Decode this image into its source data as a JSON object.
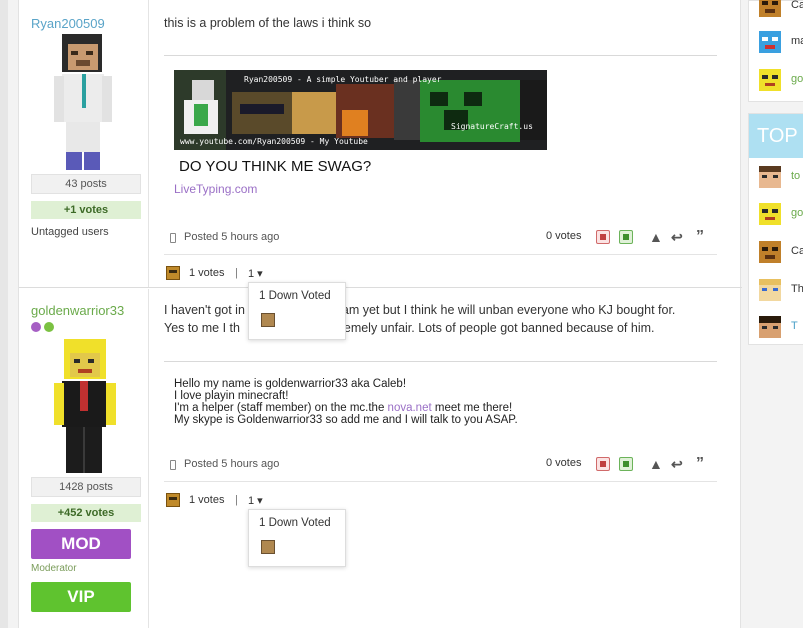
{
  "posts": [
    {
      "author": {
        "name": "Ryan200509",
        "posts": "43 posts",
        "votes": "+1 votes",
        "status": "Untagged users"
      },
      "text": "this is a problem of the laws i think so",
      "signature": {
        "banner_top": "Ryan200509 - A simple Youtuber and player",
        "banner_bottom": "www.youtube.com/Ryan200509 - My Youtube",
        "banner_brand": "SignatureCraft.us",
        "headline": "DO YOU THINK ME SWAG?",
        "link": "LiveTyping.com"
      },
      "meta": {
        "posted": "Posted 5 hours ago",
        "score": "0  votes"
      },
      "votes_row": {
        "count": "1 votes",
        "sep": "|",
        "down": "1 ▾"
      },
      "popup": "1 Down Voted"
    },
    {
      "author": {
        "name": "goldenwarrior33",
        "posts": "1428 posts",
        "votes": "+452 votes",
        "role_button": "MOD",
        "role_label": "Moderator",
        "vip_button": "VIP"
      },
      "text_line1_a": "I haven't got in",
      "text_line1_b": "ham yet but I think he will unban everyone who KJ bought for.",
      "text_line2_a": "Yes to me I th",
      "text_line2_b": "xtremely unfair. Lots of people got banned because of him.",
      "signature": {
        "line1": "Hello my name is goldenwarrior33 aka Caleb!",
        "line2": "I love playin minecraft!",
        "line3_a": "I'm a helper (staff member) on the mc.the ",
        "line3_link": "nova.net",
        "line3_b": " meet me there!",
        "line4": "My skype is Goldenwarrior33 so add me and I will talk to you ASAP."
      },
      "meta": {
        "posted": "Posted 5 hours ago",
        "score": "0  votes"
      },
      "votes_row": {
        "count": "1 votes",
        "sep": "|",
        "down": "1 ▾"
      },
      "popup": "1 Down Voted"
    }
  ],
  "sidebar": {
    "box1_items": [
      "Ca",
      "ma",
      "go"
    ],
    "box2_title": "TOP F",
    "box2_items": [
      "to",
      "go",
      "Ca",
      "Th",
      "T"
    ]
  },
  "colors": {
    "author_link": "#5aa4c8",
    "moderator": "#a150c4",
    "vip": "#5fc32f",
    "sidebar_header": "#aee0f2"
  }
}
